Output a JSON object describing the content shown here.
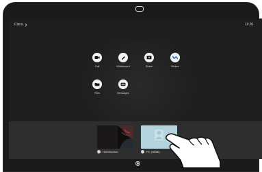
{
  "statusbar": {
    "breadcrumb": "Cisco",
    "chevron_icon": "chevron-right-icon",
    "time": "11:26"
  },
  "home": {
    "tiles": [
      {
        "label": "Call",
        "icon": "video-camera-icon"
      },
      {
        "label": "Whiteboard",
        "icon": "pen-icon"
      },
      {
        "label": "Share",
        "icon": "share-screen-icon"
      },
      {
        "label": "Webex",
        "icon": "webex-icon"
      },
      {
        "label": "Files",
        "icon": "folder-icon"
      },
      {
        "label": "Messages",
        "icon": "messages-icon"
      }
    ]
  },
  "share_sources": [
    {
      "label": "Homescreen",
      "icon": "home-dot-icon"
    },
    {
      "label": "PC (HDMI)",
      "icon": "hdmi-dot-icon"
    }
  ],
  "colors": {
    "screen_bg": "#1e1e1e",
    "tile_bg": "#f2f2f2",
    "webex_blue": "#1f68c9",
    "pc_thumb": "#b4d3dc"
  }
}
